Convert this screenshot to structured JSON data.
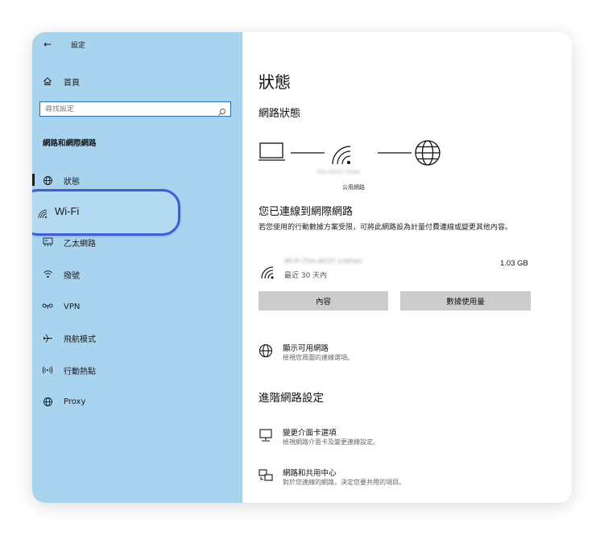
{
  "sidebar": {
    "back_label": "設定",
    "home_label": "首頁",
    "search_placeholder": "尋找設定",
    "section_title": "網路和網際網路",
    "items": [
      {
        "label": "狀態",
        "icon": "globe-icon"
      },
      {
        "label": "Wi-Fi",
        "icon": "wifi-icon"
      },
      {
        "label": "乙太網路",
        "icon": "ethernet-icon"
      },
      {
        "label": "撥號",
        "icon": "phone-icon"
      },
      {
        "label": "VPN",
        "icon": "vpn-icon"
      },
      {
        "label": "飛航模式",
        "icon": "airplane-icon"
      },
      {
        "label": "行動熱點",
        "icon": "hotspot-icon"
      },
      {
        "label": "Proxy",
        "icon": "proxy-globe-icon"
      }
    ]
  },
  "main": {
    "page_title": "狀態",
    "network_status_title": "網路狀態",
    "network_name": "Tim-AG37-5ohe",
    "network_type": "公用網路",
    "connected_heading": "您已連線到網際網路",
    "connected_desc": "若您使用的行動數據方案受限，可將此網路設為計量付費連線或變更其他內容。",
    "usage": {
      "network_name": "Wi-Fi (Tim-AG37 (rothe))",
      "period": "最近 30 天內",
      "amount": "1.03 GB"
    },
    "buttons": {
      "properties": "內容",
      "data_usage": "數據使用量"
    },
    "show_available": {
      "title": "顯示可用網路",
      "desc": "檢視您周圍的連線選項。"
    },
    "advanced_heading": "進階網路設定",
    "change_adapter": {
      "title": "變更介面卡選項",
      "desc": "檢視網路介面卡及變更連線設定。"
    },
    "sharing_center": {
      "title": "網路和共用中心",
      "desc": "對於您連線的網路，決定您要共用的項目。"
    }
  },
  "colors": {
    "sidebar_bg": "#a9d4ef",
    "highlight_border": "#3c5ce4",
    "button_bg": "#cccccc"
  }
}
